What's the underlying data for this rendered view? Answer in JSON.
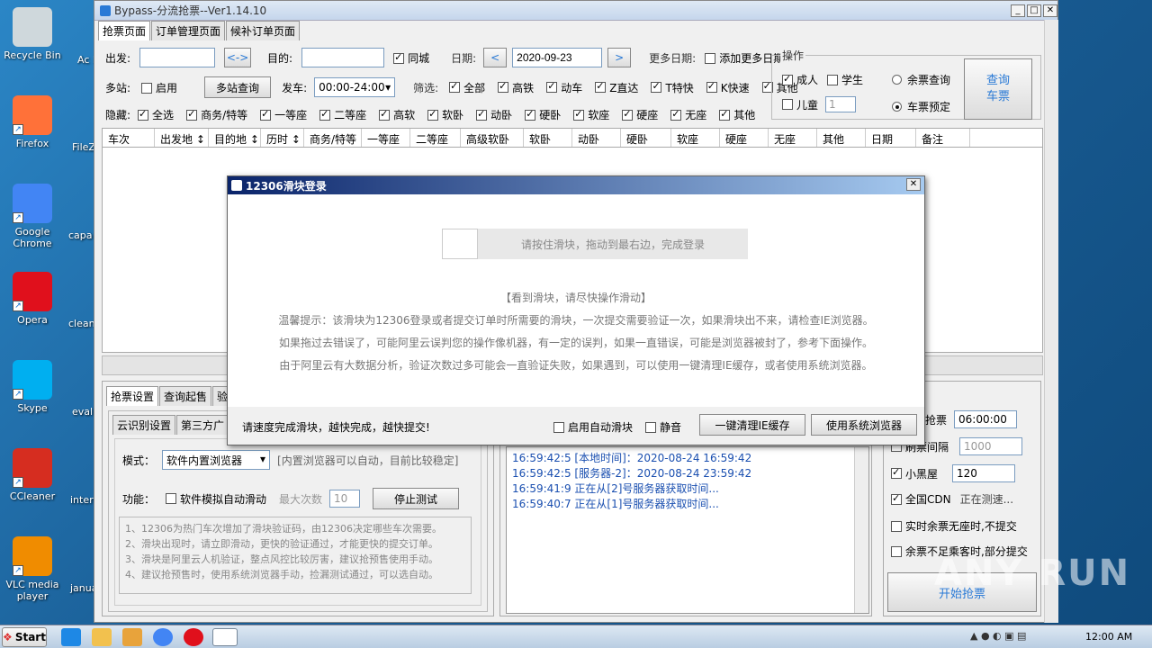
{
  "desktop": {
    "icons": [
      {
        "label": "Recycle Bin",
        "color": "#cfd8dc"
      },
      {
        "label": "Firefox",
        "color": "#ff7139"
      },
      {
        "label": "Google Chrome",
        "color": "#4285f4"
      },
      {
        "label": "Opera",
        "color": "#e0101c"
      },
      {
        "label": "Skype",
        "color": "#00aff0"
      },
      {
        "label": "CCleaner",
        "color": "#d62d20"
      },
      {
        "label": "VLC media player",
        "color": "#f08c00"
      }
    ],
    "partial_labels": [
      "Ac Rea",
      "FileZ",
      "capa",
      "clean",
      "eval",
      "inter",
      "janua"
    ]
  },
  "window": {
    "title": "Bypass-分流抢票--Ver1.14.10",
    "tabs": [
      "抢票页面",
      "订单管理页面",
      "候补订单页面"
    ]
  },
  "search": {
    "from_label": "出发:",
    "from_value": "",
    "swap": "<->",
    "to_label": "目的:",
    "to_value": "",
    "same_city": "同城",
    "date_label": "日期:",
    "date_value": "2020-09-23",
    "more_dates_label": "更多日期:",
    "add_more_dates": "添加更多日期",
    "multi_station": "多站:",
    "enable": "启用",
    "multi_query": "多站查询",
    "depart_label": "发车:",
    "depart_value": "00:00-24:00",
    "filter_label": "筛选:",
    "filters": [
      "全部",
      "高铁",
      "动车",
      "Z直达",
      "T特快",
      "K快速",
      "其他"
    ],
    "hide_label": "隐藏:",
    "hides": [
      "全选",
      "商务/特等",
      "一等座",
      "二等座",
      "高软",
      "软卧",
      "动卧",
      "硬卧",
      "软座",
      "硬座",
      "无座",
      "其他"
    ]
  },
  "ops": {
    "title": "操作",
    "adult": "成人",
    "student": "学生",
    "child": "儿童",
    "child_count": "1",
    "remain_query": "余票查询",
    "book": "车票预定",
    "query_button": "查询\n车票"
  },
  "table": {
    "columns": [
      "车次",
      "出发地 ↕",
      "目的地 ↕",
      "历时 ↕",
      "商务/特等",
      "一等座",
      "二等座",
      "高级软卧",
      "软卧",
      "动卧",
      "硬卧",
      "软座",
      "硬座",
      "无座",
      "其他",
      "日期",
      "备注"
    ]
  },
  "lower": {
    "tabs": [
      "抢票设置",
      "查询起售",
      "验"
    ],
    "subtabs": [
      "云识别设置",
      "第三方广"
    ],
    "mode_label": "模式：",
    "mode_value": "软件内置浏览器",
    "mode_note": "[内置浏览器可以自动，目前比较稳定]",
    "func_label": "功能：",
    "auto_slide": "软件模拟自动滑动",
    "max_label": "最大次数",
    "max_value": "10",
    "stop_test": "停止测试",
    "notes": [
      "1、12306为热门车次增加了滑块验证码，由12306决定哪些车次需要。",
      "2、滑块出现时，请立即滑动，更快的验证通过，才能更快的提交订单。",
      "3、滑块是阿里云人机验证，整点风控比较厉害，建议抢预售使用手动。",
      "4、建议抢预售时，使用系统浏览器手动，捡漏测试通过，可以选自动。"
    ]
  },
  "log": [
    "16:59:42:5  [本地时间]：2020-08-24 16:59:42",
    "16:59:42:5  [服务器-2]：2020-08-24 23:59:42",
    "16:59:41:9  正在从[2]号服务器获取时间...",
    "16:59:40:7  正在从[1]号服务器获取时间..."
  ],
  "right": {
    "grab_label": "抢票",
    "grab_time": "06:00:00",
    "interval_label": "刷票间隔",
    "interval_value": "1000",
    "blackroom": "小黑屋",
    "blackroom_value": "120",
    "cdn": "全国CDN",
    "cdn_status": "正在测速...",
    "no_seat": "实时余票无座时,不提交",
    "partial": "余票不足乘客时,部分提交",
    "start": "开始抢票"
  },
  "dialog": {
    "title": "12306滑块登录",
    "slider_text": "请按住滑块，拖动到最右边，完成登录",
    "notice": "【看到滑块，请尽快操作滑动】",
    "tips": [
      "温馨提示：该滑块为12306登录或者提交订单时所需要的滑块，一次提交需要验证一次，如果滑块出不来，请检查IE浏览器。",
      "如果拖过去错误了，可能阿里云误判您的操作像机器，有一定的误判，如果一直错误，可能是浏览器被封了，参考下面操作。",
      "由于阿里云有大数据分析，验证次数过多可能会一直验证失败，如果遇到，可以使用一键清理IE缓存，或者使用系统浏览器。"
    ],
    "footer": "请速度完成滑块，越快完成，越快提交!",
    "auto_slide": "启用自动滑块",
    "mute": "静音",
    "clear_ie": "一键清理IE缓存",
    "sys_browser": "使用系统浏览器"
  },
  "watermark": "ANY RUN",
  "taskbar": {
    "start": "Start",
    "clock": "12:00 AM"
  }
}
